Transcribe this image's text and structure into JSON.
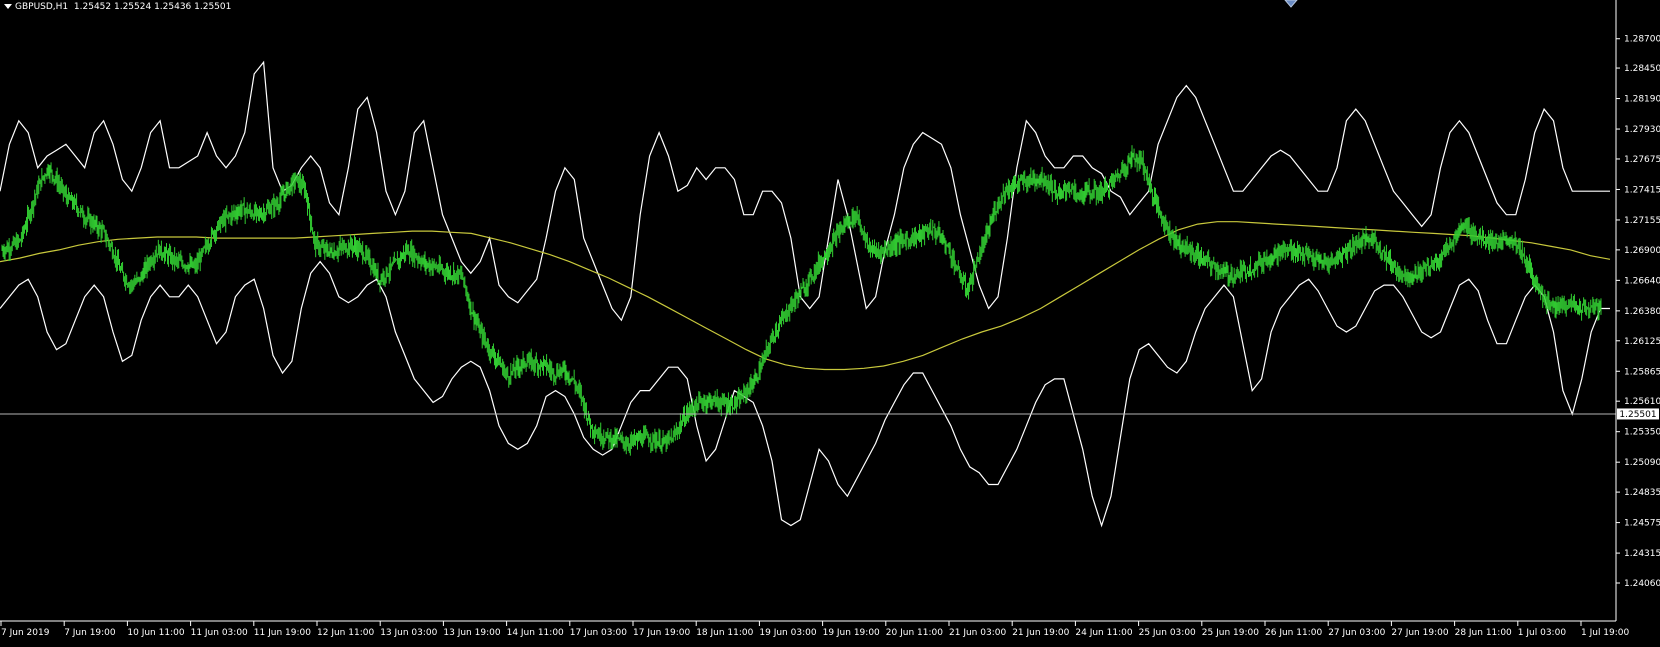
{
  "header": {
    "symbol_timeframe": "GBPUSD,H1",
    "ohlc": "1.25452 1.25524 1.25436 1.25501"
  },
  "colors": {
    "background": "#000000",
    "candles": "#32cd32",
    "bands": "#ffffff",
    "moving_average": "#c8c83c",
    "bid_line": "#b4b4b4",
    "bid_label_bg": "#ffffff",
    "axis_text": "#ffffff"
  },
  "chart_data": {
    "type": "line",
    "symbol": "GBPUSD",
    "timeframe": "H1",
    "ylim": [
      1.2406,
      1.288
    ],
    "y_ticks": [
      "1.28700",
      "1.28450",
      "1.28190",
      "1.27930",
      "1.27675",
      "1.27415",
      "1.27155",
      "1.26900",
      "1.26640",
      "1.26380",
      "1.26125",
      "1.25865",
      "1.25610",
      "1.25350",
      "1.25090",
      "1.24835",
      "1.24575",
      "1.24315",
      "1.24060"
    ],
    "x_ticks": [
      "7 Jun 2019",
      "7 Jun 19:00",
      "10 Jun 11:00",
      "11 Jun 03:00",
      "11 Jun 19:00",
      "12 Jun 11:00",
      "13 Jun 03:00",
      "13 Jun 19:00",
      "14 Jun 11:00",
      "17 Jun 03:00",
      "17 Jun 19:00",
      "18 Jun 11:00",
      "19 Jun 03:00",
      "19 Jun 19:00",
      "20 Jun 11:00",
      "21 Jun 03:00",
      "21 Jun 19:00",
      "24 Jun 11:00",
      "25 Jun 03:00",
      "25 Jun 19:00",
      "26 Jun 11:00",
      "27 Jun 03:00",
      "27 Jun 19:00",
      "28 Jun 11:00",
      "1 Jul 03:00",
      "1 Jul 19:00"
    ],
    "current_price": "1.25501",
    "series": [
      {
        "style": "candles",
        "close": [
          1.269,
          1.2693,
          1.2698,
          1.2722,
          1.2745,
          1.276,
          1.2748,
          1.2735,
          1.2728,
          1.2718,
          1.2712,
          1.2705,
          1.269,
          1.267,
          1.266,
          1.2665,
          1.268,
          1.269,
          1.2685,
          1.268,
          1.2678,
          1.2675,
          1.269,
          1.2705,
          1.2715,
          1.272,
          1.2725,
          1.2722,
          1.272,
          1.2725,
          1.273,
          1.2742,
          1.275,
          1.274,
          1.2695,
          1.269,
          1.2688,
          1.2692,
          1.2694,
          1.269,
          1.268,
          1.2665,
          1.2672,
          1.268,
          1.269,
          1.2685,
          1.2678,
          1.2676,
          1.2672,
          1.267,
          1.2668,
          1.264,
          1.262,
          1.2605,
          1.2595,
          1.2582,
          1.259,
          1.2595,
          1.2593,
          1.2592,
          1.2585,
          1.2588,
          1.258,
          1.2565,
          1.254,
          1.2532,
          1.253,
          1.2528,
          1.2525,
          1.2528,
          1.253,
          1.2528,
          1.2525,
          1.253,
          1.2545,
          1.2555,
          1.256,
          1.2562,
          1.256,
          1.2558,
          1.256,
          1.257,
          1.258,
          1.26,
          1.262,
          1.2632,
          1.2645,
          1.2655,
          1.2668,
          1.268,
          1.2692,
          1.2705,
          1.2715,
          1.272,
          1.2695,
          1.2688,
          1.269,
          1.2695,
          1.2698,
          1.27,
          1.2703,
          1.2708,
          1.2702,
          1.269,
          1.267,
          1.2655,
          1.268,
          1.27,
          1.2725,
          1.274,
          1.2745,
          1.2748,
          1.275,
          1.2752,
          1.2745,
          1.2735,
          1.2745,
          1.2735,
          1.274,
          1.2738,
          1.2742,
          1.275,
          1.276,
          1.277,
          1.2765,
          1.274,
          1.272,
          1.2705,
          1.2695,
          1.269,
          1.2685,
          1.268,
          1.2675,
          1.267,
          1.2668,
          1.2672,
          1.2675,
          1.268,
          1.2685,
          1.2688,
          1.269,
          1.2688,
          1.2685,
          1.268,
          1.2678,
          1.2682,
          1.2688,
          1.2695,
          1.2698,
          1.27,
          1.269,
          1.2678,
          1.267,
          1.2668,
          1.267,
          1.2675,
          1.268,
          1.269,
          1.27,
          1.271,
          1.2705,
          1.27,
          1.2698,
          1.2695,
          1.27,
          1.269,
          1.2675,
          1.266,
          1.2645,
          1.264,
          1.2645,
          1.2642,
          1.264,
          1.264
        ]
      },
      {
        "name": "",
        "style": "line",
        "values": [
          1.274,
          1.278,
          1.28,
          1.279,
          1.276,
          1.277,
          1.2775,
          1.278,
          1.277,
          1.276,
          1.279,
          1.28,
          1.278,
          1.275,
          1.274,
          1.276,
          1.279,
          1.28,
          1.276,
          1.276,
          1.2765,
          1.277,
          1.279,
          1.277,
          1.276,
          1.277,
          1.279,
          1.284,
          1.285,
          1.276,
          1.274,
          1.2745,
          1.276,
          1.277,
          1.276,
          1.273,
          1.272,
          1.276,
          1.281,
          1.282,
          1.279,
          1.274,
          1.272,
          1.274,
          1.279,
          1.28,
          1.276,
          1.272,
          1.27,
          1.268,
          1.267,
          1.268,
          1.27,
          1.266,
          1.265,
          1.2645,
          1.2655,
          1.2665,
          1.27,
          1.274,
          1.276,
          1.275,
          1.27,
          1.268,
          1.266,
          1.264,
          1.263,
          1.265,
          1.272,
          1.277,
          1.279,
          1.277,
          1.274,
          1.2745,
          1.276,
          1.275,
          1.276,
          1.276,
          1.275,
          1.272,
          1.272,
          1.274,
          1.274,
          1.273,
          1.27,
          1.265,
          1.264,
          1.265,
          1.27,
          1.275,
          1.272,
          1.268,
          1.264,
          1.265,
          1.269,
          1.272,
          1.276,
          1.278,
          1.279,
          1.2785,
          1.278,
          1.276,
          1.272,
          1.269,
          1.266,
          1.264,
          1.265,
          1.27,
          1.276,
          1.28,
          1.279,
          1.277,
          1.276,
          1.276,
          1.277,
          1.277,
          1.276,
          1.2755,
          1.274,
          1.2735,
          1.272,
          1.273,
          1.274,
          1.278,
          1.28,
          1.282,
          1.283,
          1.282,
          1.28,
          1.278,
          1.276,
          1.274,
          1.274,
          1.275,
          1.276,
          1.277,
          1.2775,
          1.277,
          1.276,
          1.275,
          1.274,
          1.274,
          1.276,
          1.28,
          1.281,
          1.28,
          1.278,
          1.276,
          1.274,
          1.273,
          1.272,
          1.271,
          1.272,
          1.276,
          1.279,
          1.28,
          1.279,
          1.277,
          1.275,
          1.273,
          1.272,
          1.272,
          1.275,
          1.279,
          1.281,
          1.28,
          1.276,
          1.274,
          1.274,
          1.274,
          1.274,
          1.274
        ]
      },
      {
        "name": "",
        "style": "line",
        "values": [
          1.264,
          1.265,
          1.266,
          1.2665,
          1.265,
          1.262,
          1.2605,
          1.261,
          1.263,
          1.265,
          1.266,
          1.265,
          1.262,
          1.2595,
          1.26,
          1.263,
          1.265,
          1.266,
          1.265,
          1.265,
          1.266,
          1.265,
          1.263,
          1.261,
          1.262,
          1.265,
          1.266,
          1.2665,
          1.264,
          1.26,
          1.2585,
          1.2595,
          1.264,
          1.267,
          1.268,
          1.267,
          1.265,
          1.2645,
          1.265,
          1.266,
          1.2665,
          1.265,
          1.262,
          1.26,
          1.258,
          1.257,
          1.256,
          1.2565,
          1.258,
          1.259,
          1.2595,
          1.259,
          1.257,
          1.254,
          1.2525,
          1.252,
          1.2525,
          1.254,
          1.2565,
          1.257,
          1.2565,
          1.255,
          1.253,
          1.252,
          1.2515,
          1.252,
          1.254,
          1.256,
          1.257,
          1.257,
          1.258,
          1.259,
          1.259,
          1.258,
          1.254,
          1.251,
          1.252,
          1.2545,
          1.257,
          1.2565,
          1.256,
          1.254,
          1.251,
          1.246,
          1.2455,
          1.246,
          1.249,
          1.252,
          1.251,
          1.249,
          1.248,
          1.2495,
          1.251,
          1.2525,
          1.2545,
          1.256,
          1.2575,
          1.2585,
          1.2585,
          1.257,
          1.2555,
          1.254,
          1.252,
          1.2505,
          1.25,
          1.249,
          1.249,
          1.2505,
          1.252,
          1.254,
          1.256,
          1.2575,
          1.258,
          1.258,
          1.255,
          1.252,
          1.248,
          1.2455,
          1.248,
          1.253,
          1.258,
          1.2605,
          1.261,
          1.26,
          1.259,
          1.2585,
          1.2595,
          1.262,
          1.264,
          1.265,
          1.266,
          1.265,
          1.261,
          1.257,
          1.258,
          1.262,
          1.264,
          1.265,
          1.266,
          1.2665,
          1.2655,
          1.264,
          1.2625,
          1.262,
          1.2625,
          1.264,
          1.2655,
          1.266,
          1.266,
          1.265,
          1.2635,
          1.262,
          1.2615,
          1.262,
          1.264,
          1.266,
          1.2665,
          1.2655,
          1.263,
          1.261,
          1.261,
          1.263,
          1.265,
          1.266,
          1.265,
          1.262,
          1.257,
          1.255,
          1.258,
          1.262,
          1.264,
          1.264
        ]
      },
      {
        "name": "",
        "style": "line",
        "values": [
          1.268,
          1.2683,
          1.2687,
          1.269,
          1.2694,
          1.2697,
          1.2699,
          1.27,
          1.2701,
          1.2701,
          1.2701,
          1.27,
          1.27,
          1.27,
          1.27,
          1.27,
          1.2701,
          1.2702,
          1.2703,
          1.2704,
          1.2705,
          1.2706,
          1.2706,
          1.2705,
          1.2704,
          1.27,
          1.2696,
          1.2691,
          1.2686,
          1.268,
          1.2673,
          1.2666,
          1.2658,
          1.265,
          1.2641,
          1.2632,
          1.2623,
          1.2614,
          1.2605,
          1.2597,
          1.2592,
          1.2589,
          1.2588,
          1.2588,
          1.2589,
          1.2591,
          1.2595,
          1.26,
          1.2607,
          1.2614,
          1.262,
          1.2625,
          1.2632,
          1.264,
          1.265,
          1.266,
          1.267,
          1.268,
          1.269,
          1.2699,
          1.2707,
          1.2712,
          1.2714,
          1.2714,
          1.2713,
          1.2712,
          1.2711,
          1.271,
          1.2709,
          1.2708,
          1.2707,
          1.2706,
          1.2705,
          1.2704,
          1.2703,
          1.2702,
          1.27,
          1.2698,
          1.2696,
          1.2693,
          1.269,
          1.2685,
          1.2682
        ]
      }
    ]
  }
}
